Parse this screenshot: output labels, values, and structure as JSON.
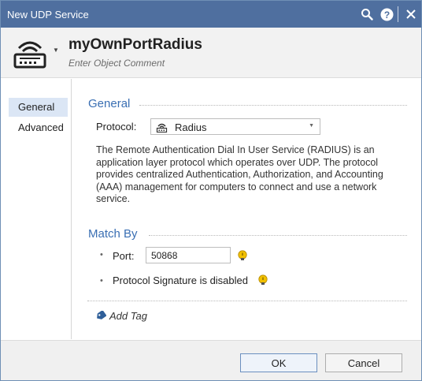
{
  "window": {
    "title": "New UDP Service",
    "icons": [
      "search-icon",
      "help-icon",
      "close-icon"
    ]
  },
  "header": {
    "object_name": "myOwnPortRadius",
    "comment_placeholder": "Enter Object Comment",
    "icon": "udp-service-icon"
  },
  "sidebar": {
    "items": [
      {
        "label": "General",
        "active": true
      },
      {
        "label": "Advanced",
        "active": false
      }
    ]
  },
  "general": {
    "section_title": "General",
    "protocol_label": "Protocol:",
    "protocol_value": "Radius",
    "description": "The Remote Authentication Dial In User Service (RADIUS) is an application layer protocol which operates over UDP. The protocol provides centralized Authentication, Authorization, and Accounting (AAA) management for computers to connect and use a network service."
  },
  "match_by": {
    "section_title": "Match By",
    "port_label": "Port:",
    "port_value": "50868",
    "signature_text": "Protocol Signature is disabled"
  },
  "tags": {
    "add_tag_label": "Add Tag"
  },
  "footer": {
    "ok_label": "OK",
    "cancel_label": "Cancel"
  },
  "colors": {
    "titlebar": "#4f6f9f",
    "section_title": "#3a6fb3",
    "nav_active": "#dbe6f5",
    "bulb": "#f2c100"
  }
}
